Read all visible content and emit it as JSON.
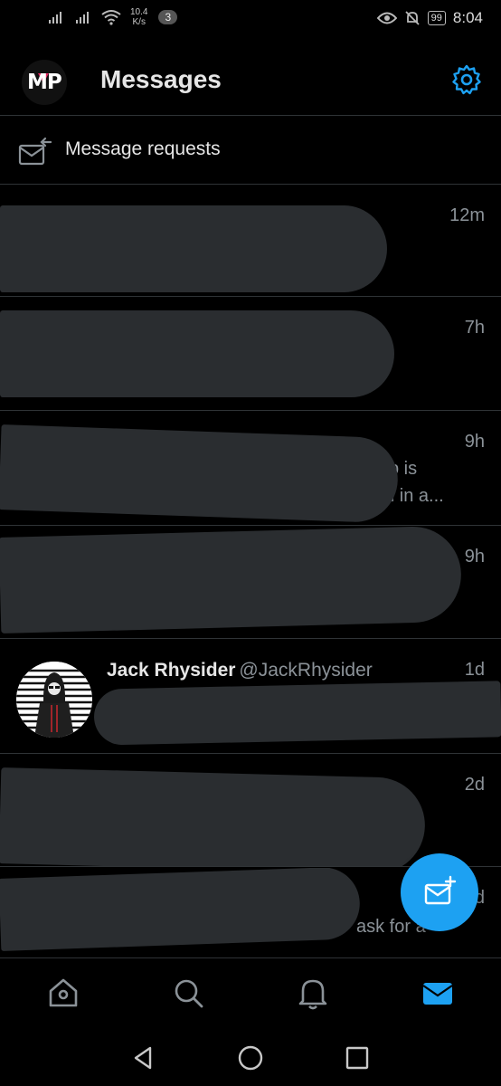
{
  "status_bar": {
    "net_speed_value": "10.4",
    "net_speed_unit": "K/s",
    "notification_count": "3",
    "battery": "99",
    "time": "8:04"
  },
  "header": {
    "logo_text": "MP",
    "title": "Messages"
  },
  "requests": {
    "label": "Message requests"
  },
  "conversations": [
    {
      "time": "12m"
    },
    {
      "time": "7h"
    },
    {
      "time": "9h",
      "snippet_line1": "p is",
      "snippet_line2": "ed in a..."
    },
    {
      "time": "9h"
    },
    {
      "time": "1d",
      "name": "Jack Rhysider",
      "handle": "@JackRhysider"
    },
    {
      "time": "2d"
    },
    {
      "time": "d",
      "snippet_line1": "ask for a"
    }
  ],
  "colors": {
    "accent": "#1da1f2",
    "background": "#000000",
    "divider": "#2f3336",
    "redaction": "#2a2d30",
    "secondary_text": "#8b9298"
  },
  "icons": {
    "header_right": "gear-icon",
    "requests": "mail-request-icon",
    "fab": "compose-message-icon",
    "nav": [
      "home-icon",
      "search-icon",
      "bell-icon",
      "mail-icon"
    ],
    "system": [
      "back-icon",
      "home-circle-icon",
      "recents-icon"
    ]
  }
}
